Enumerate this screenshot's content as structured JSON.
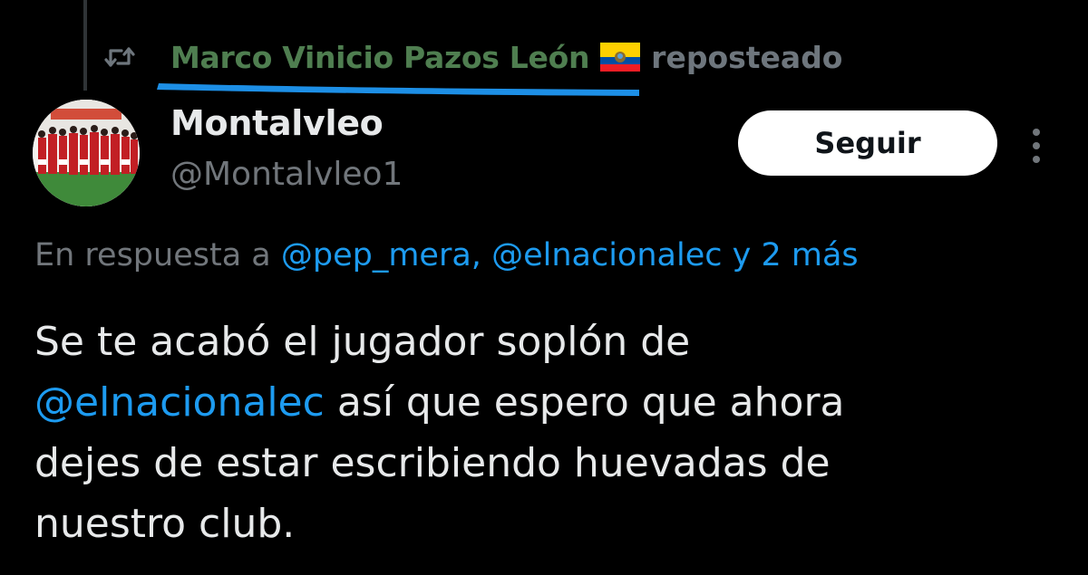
{
  "repost": {
    "reposter_name": "Marco Vinicio Pazos León",
    "flag_icon": "ecuador-flag",
    "label": "reposteado",
    "name_color": "#4f7e50",
    "highlight_color": "#1d8fe6"
  },
  "author": {
    "display_name": "Montalvleo",
    "handle": "@Montalvleo1",
    "avatar_icon": "team-photo-avatar"
  },
  "actions": {
    "follow_label": "Seguir",
    "more_icon": "more-vertical-icon"
  },
  "reply_context": {
    "prefix": "En respuesta a",
    "mention_1": "@pep_mera,",
    "mention_2": "@elnacionalec",
    "suffix": "y 2 más"
  },
  "tweet": {
    "line1": "Se te acabó el jugador soplón de",
    "line2_mention": "@elnacionalec",
    "line2_rest": " así que espero que ahora",
    "line3": "dejes de estar escribiendo huevadas de",
    "line4": "nuestro club."
  },
  "colors": {
    "background": "#000000",
    "text": "#e7e9ea",
    "secondary": "#71767b",
    "link": "#1d9bf0"
  }
}
